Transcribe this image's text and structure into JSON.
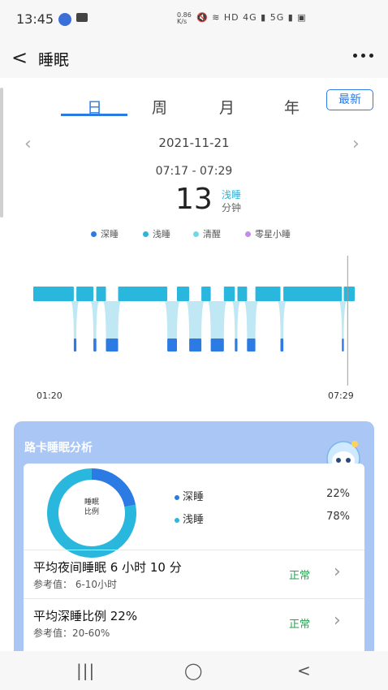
{
  "status": {
    "time": "13:45",
    "speed_top": "0.86",
    "speed_bottom": "K/s",
    "icons_text": "🔇 ≋ HD 4G ▮ 5G ▮ ▣"
  },
  "header": {
    "back_glyph": "<",
    "title": "睡眠",
    "more_icon": "more-dots-icon"
  },
  "tabs": [
    {
      "label": "日"
    },
    {
      "label": "周"
    },
    {
      "label": "月"
    },
    {
      "label": "年"
    }
  ],
  "active_tab": "日",
  "latest_button": "最新",
  "date_nav": {
    "prev": "‹",
    "next": "›",
    "date": "2021-11-21"
  },
  "selection": {
    "range": "07:17 - 07:29",
    "minutes": "13",
    "type": "浅睡",
    "unit": "分钟"
  },
  "legend": [
    {
      "label": "深睡",
      "color": "#2c7be5"
    },
    {
      "label": "浅睡",
      "color": "#2bb6d8"
    },
    {
      "label": "清醒",
      "color": "#6fd8e8"
    },
    {
      "label": "零星小睡",
      "color": "#c58be8"
    }
  ],
  "colors": {
    "deep": "#2c7be5",
    "light": "#29b7dd",
    "accent": "#2c7be5",
    "card_bg": "#a9c6f4",
    "normal": "#2e9e55"
  },
  "chart_data": {
    "type": "area",
    "x_start": "01:20",
    "x_end": "07:29",
    "levels": [
      "浅睡",
      "深睡"
    ],
    "segments": [
      {
        "stage": "浅睡",
        "start": 0.0,
        "end": 0.126
      },
      {
        "stage": "深睡",
        "start": 0.126,
        "end": 0.134
      },
      {
        "stage": "浅睡",
        "start": 0.134,
        "end": 0.187
      },
      {
        "stage": "深睡",
        "start": 0.187,
        "end": 0.196
      },
      {
        "stage": "浅睡",
        "start": 0.196,
        "end": 0.226
      },
      {
        "stage": "深睡",
        "start": 0.226,
        "end": 0.264
      },
      {
        "stage": "浅睡",
        "start": 0.264,
        "end": 0.417
      },
      {
        "stage": "深睡",
        "start": 0.417,
        "end": 0.447
      },
      {
        "stage": "浅睡",
        "start": 0.447,
        "end": 0.485
      },
      {
        "stage": "深睡",
        "start": 0.485,
        "end": 0.523
      },
      {
        "stage": "浅睡",
        "start": 0.523,
        "end": 0.552
      },
      {
        "stage": "深睡",
        "start": 0.552,
        "end": 0.593
      },
      {
        "stage": "浅睡",
        "start": 0.593,
        "end": 0.627
      },
      {
        "stage": "深睡",
        "start": 0.627,
        "end": 0.635
      },
      {
        "stage": "浅睡",
        "start": 0.635,
        "end": 0.665
      },
      {
        "stage": "深睡",
        "start": 0.665,
        "end": 0.691
      },
      {
        "stage": "浅睡",
        "start": 0.691,
        "end": 0.769
      },
      {
        "stage": "深睡",
        "start": 0.769,
        "end": 0.778
      },
      {
        "stage": "浅睡",
        "start": 0.778,
        "end": 0.96
      },
      {
        "stage": "深睡",
        "start": 0.96,
        "end": 0.966
      },
      {
        "stage": "浅睡",
        "start": 0.966,
        "end": 1.0
      }
    ],
    "selected_marker": 0.978
  },
  "analysis": {
    "title": "路卡睡眠分析",
    "donut_label": [
      "睡眠",
      "比例"
    ],
    "deep": {
      "label": "深睡",
      "pct": "22%",
      "value": 22
    },
    "light": {
      "label": "浅睡",
      "pct": "78%",
      "value": 78
    },
    "rows": [
      {
        "title": "平均夜间睡眠 6 小时 10 分",
        "sub": "参考值： 6-10小时",
        "status": "正常"
      },
      {
        "title": "平均深睡比例 22%",
        "sub": "参考值：20-60%",
        "status": "正常"
      }
    ]
  },
  "navbar": {
    "recent": "|||",
    "home": "◯",
    "back": "<"
  }
}
